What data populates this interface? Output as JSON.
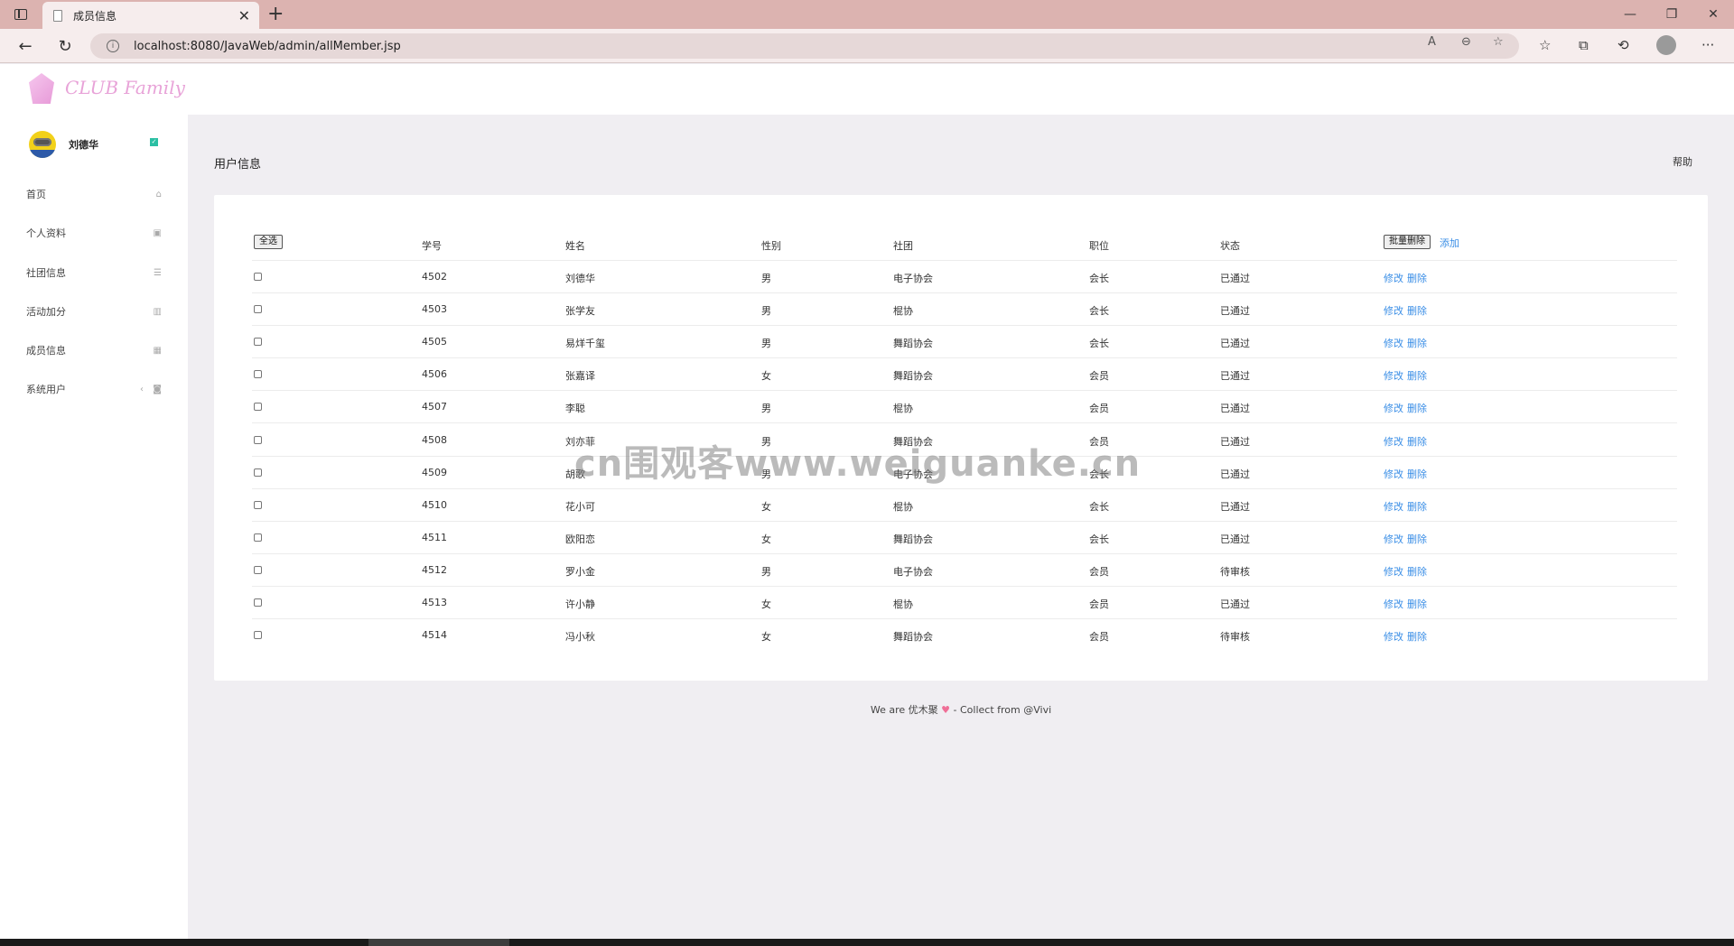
{
  "browser": {
    "tab_title": "成员信息",
    "url": "localhost:8080/JavaWeb/admin/allMember.jsp",
    "new_tab": "+",
    "close_tab": "✕"
  },
  "app": {
    "logo_text": "CLUB Family"
  },
  "sidebar": {
    "user_name": "刘德华",
    "items": [
      {
        "label": "首页",
        "icon": "home-icon"
      },
      {
        "label": "个人资料",
        "icon": "contact-card-icon"
      },
      {
        "label": "社团信息",
        "icon": "list-icon"
      },
      {
        "label": "活动加分",
        "icon": "bar-chart-icon"
      },
      {
        "label": "成员信息",
        "icon": "table-icon"
      },
      {
        "label": "系统用户",
        "icon": "briefcase-icon"
      }
    ]
  },
  "main": {
    "title": "用户信息",
    "help": "帮助"
  },
  "table": {
    "select_all": "全选",
    "batch_delete": "批量删除",
    "add": "添加",
    "headers": [
      "学号",
      "姓名",
      "性别",
      "社团",
      "职位",
      "状态"
    ],
    "edit_label": "修改",
    "delete_label": "删除",
    "rows": [
      [
        "4502",
        "刘德华",
        "男",
        "电子协会",
        "会长",
        "已通过"
      ],
      [
        "4503",
        "张学友",
        "男",
        "棍协",
        "会长",
        "已通过"
      ],
      [
        "4505",
        "易烊千玺",
        "男",
        "舞蹈协会",
        "会长",
        "已通过"
      ],
      [
        "4506",
        "张嘉译",
        "女",
        "舞蹈协会",
        "会员",
        "已通过"
      ],
      [
        "4507",
        "李聪",
        "男",
        "棍协",
        "会员",
        "已通过"
      ],
      [
        "4508",
        "刘亦菲",
        "男",
        "舞蹈协会",
        "会员",
        "已通过"
      ],
      [
        "4509",
        "胡歌",
        "男",
        "电子协会",
        "会长",
        "已通过"
      ],
      [
        "4510",
        "花小可",
        "女",
        "棍协",
        "会长",
        "已通过"
      ],
      [
        "4511",
        "欧阳恋",
        "女",
        "舞蹈协会",
        "会长",
        "已通过"
      ],
      [
        "4512",
        "罗小金",
        "男",
        "电子协会",
        "会员",
        "待审核"
      ],
      [
        "4513",
        "许小静",
        "女",
        "棍协",
        "会员",
        "已通过"
      ],
      [
        "4514",
        "冯小秋",
        "女",
        "舞蹈协会",
        "会员",
        "待审核"
      ]
    ]
  },
  "footer": {
    "prefix": "We are 优木聚",
    "heart": "♥",
    "suffix": "- Collect from @Vivi"
  },
  "watermark": "cn围观客www.weiguanke.cn",
  "colors": {
    "tabbar": "#dcb3b0",
    "accent_link": "#3a8ee6",
    "page_bg": "#f0eef2"
  }
}
